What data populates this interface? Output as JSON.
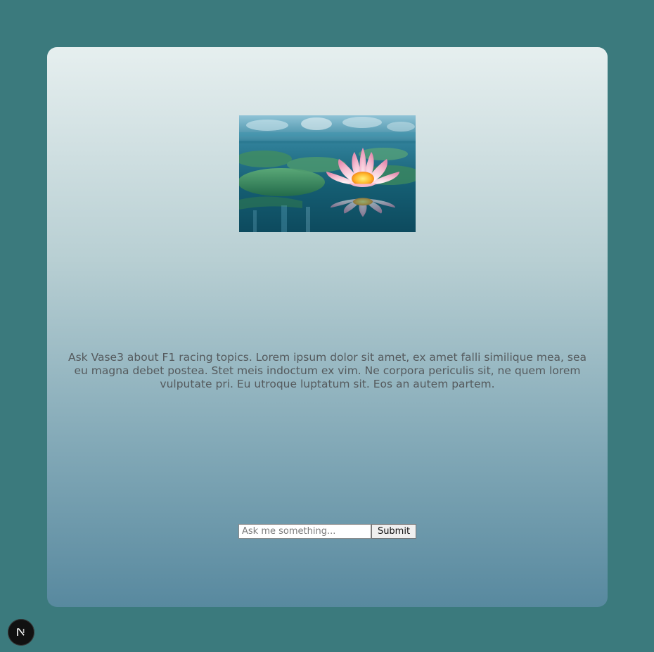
{
  "background_color": "#3b7a7d",
  "card": {
    "gradient_top": "#e6efef",
    "gradient_bottom": "#58899f"
  },
  "hero_image": {
    "icon": "lotus-flower-photo"
  },
  "description": "Ask Vase3 about F1 racing topics. Lorem ipsum dolor sit amet, ex amet falli similique mea, sea eu magna debet postea. Stet meis indoctum ex vim. Ne corpora periculis sit, ne quem lorem vulputate pri. Eu utroque luptatum sit. Eos an autem partem.",
  "form": {
    "input_placeholder": "Ask me something...",
    "input_value": "",
    "submit_label": "Submit"
  },
  "dev_badge": {
    "icon": "nextjs-logo-icon",
    "label": "N"
  }
}
